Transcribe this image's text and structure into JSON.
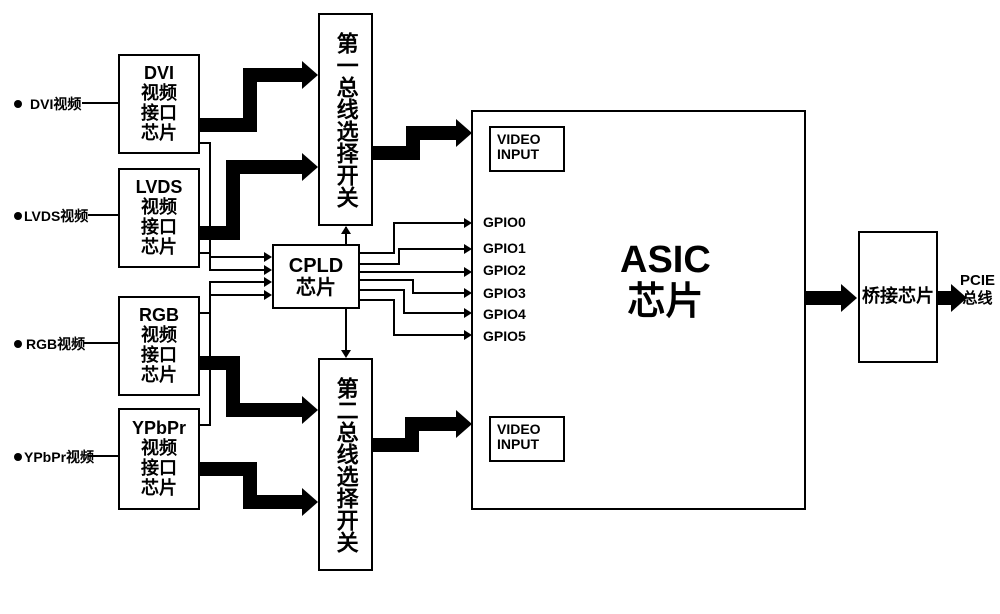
{
  "inputs": {
    "dvi": {
      "label": "DVI视频",
      "chip": "DVI\n视频\n接口\n芯片"
    },
    "lvds": {
      "label": "LVDS视频",
      "chip": "LVDS\n视频\n接口\n芯片"
    },
    "rgb": {
      "label": "RGB视频",
      "chip": "RGB\n视频\n接口\n芯片"
    },
    "ypbpr": {
      "label": "YPbPr视频",
      "chip": "YPbPr\n视频\n接口\n芯片"
    }
  },
  "switch1": "第一总线选择开关",
  "switch2": "第二总线选择开关",
  "cpld": "CPLD\n芯片",
  "asic": {
    "title": "ASIC\n芯片",
    "video_input_top": "VIDEO\nINPUT",
    "video_input_bottom": "VIDEO\nINPUT",
    "gpio": [
      "GPIO0",
      "GPIO1",
      "GPIO2",
      "GPIO3",
      "GPIO4",
      "GPIO5"
    ]
  },
  "bridge": "桥接芯片",
  "pcie": "PCIE\n总线"
}
